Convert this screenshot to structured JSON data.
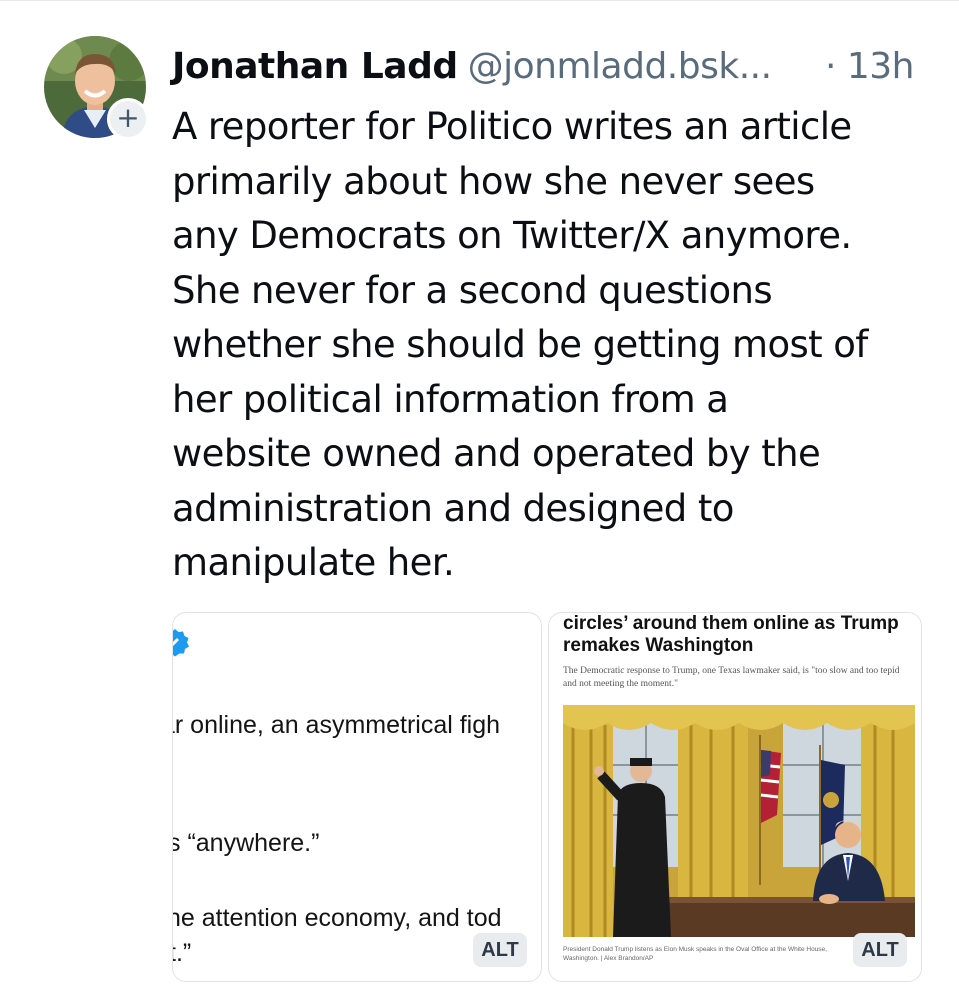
{
  "post": {
    "author_name": "Jonathan Ladd",
    "author_handle": "@jonmladd.bsk...",
    "separator": "·",
    "timestamp": "13h",
    "follow_badge": "+",
    "text_lines": [
      "A reporter for Politico writes an article",
      "primarily about how she never sees",
      "any Democrats on Twitter/X anymore.",
      "She never for a second questions",
      "whether she should be getting most of",
      "her political information from a",
      "website owned and operated by the",
      "administration and designed to",
      "manipulate her."
    ]
  },
  "images": [
    {
      "alt_label": "ALT",
      "icon": "verified-badge-icon",
      "lines": [
        "ar online, an asymmetrical figh",
        "s “anywhere.”",
        "ne attention economy, and tod",
        "t.”"
      ]
    },
    {
      "alt_label": "ALT",
      "headline_top": "circles’ around them online as Trump",
      "headline_bottom": "remakes Washington",
      "dek": "The Democratic response to Trump, one Texas lawmaker said, is \"too slow and too tepid and not meeting the moment.\"",
      "caption": "President Donald Trump listens as Elon Musk speaks in the Oval Office at the White House, Washington. | Alex Brandon/AP"
    }
  ],
  "colors": {
    "text": "#0b0f14",
    "muted": "#5a6b7c",
    "verified_blue": "#1d9bf0",
    "border": "#dfe3e7"
  }
}
